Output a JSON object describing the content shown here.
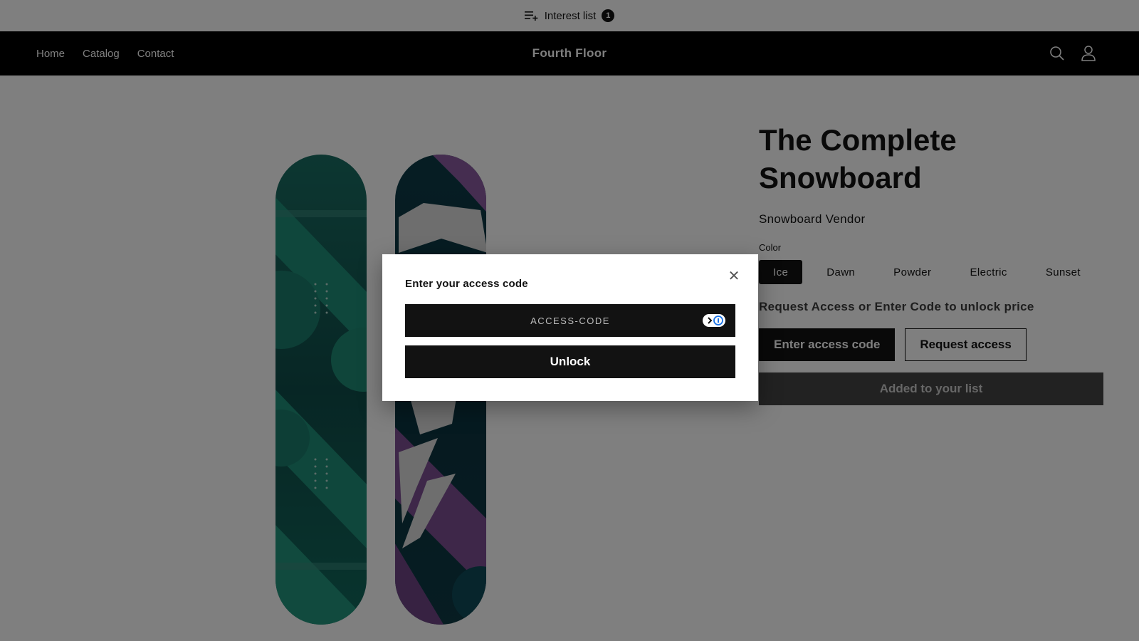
{
  "announcement": {
    "icon": "list-add-icon",
    "label": "Interest list",
    "count": "1"
  },
  "header": {
    "nav": [
      "Home",
      "Catalog",
      "Contact"
    ],
    "store_name": "Fourth Floor",
    "icons": [
      "search-icon",
      "account-icon"
    ]
  },
  "product": {
    "title": "The Complete Snowboard",
    "vendor": "Snowboard Vendor",
    "color_label": "Color",
    "colors": [
      "Ice",
      "Dawn",
      "Powder",
      "Electric",
      "Sunset"
    ],
    "selected_color": "Ice",
    "unlock_note": "Request Access or Enter Code to unlock price",
    "enter_code_label": "Enter access code",
    "request_access_label": "Request access",
    "added_label": "Added to your list"
  },
  "modal": {
    "title": "Enter your access code",
    "close_icon": "close-icon",
    "input_placeholder": "ACCESS-CODE",
    "input_value": "",
    "unlock_label": "Unlock"
  },
  "colors": {
    "header_bg": "#000000",
    "button_dark": "#121212",
    "overlay": "rgba(0,0,0,0.5)",
    "board_teal": "#1f8f78",
    "board_purple": "#8a5aa0"
  }
}
